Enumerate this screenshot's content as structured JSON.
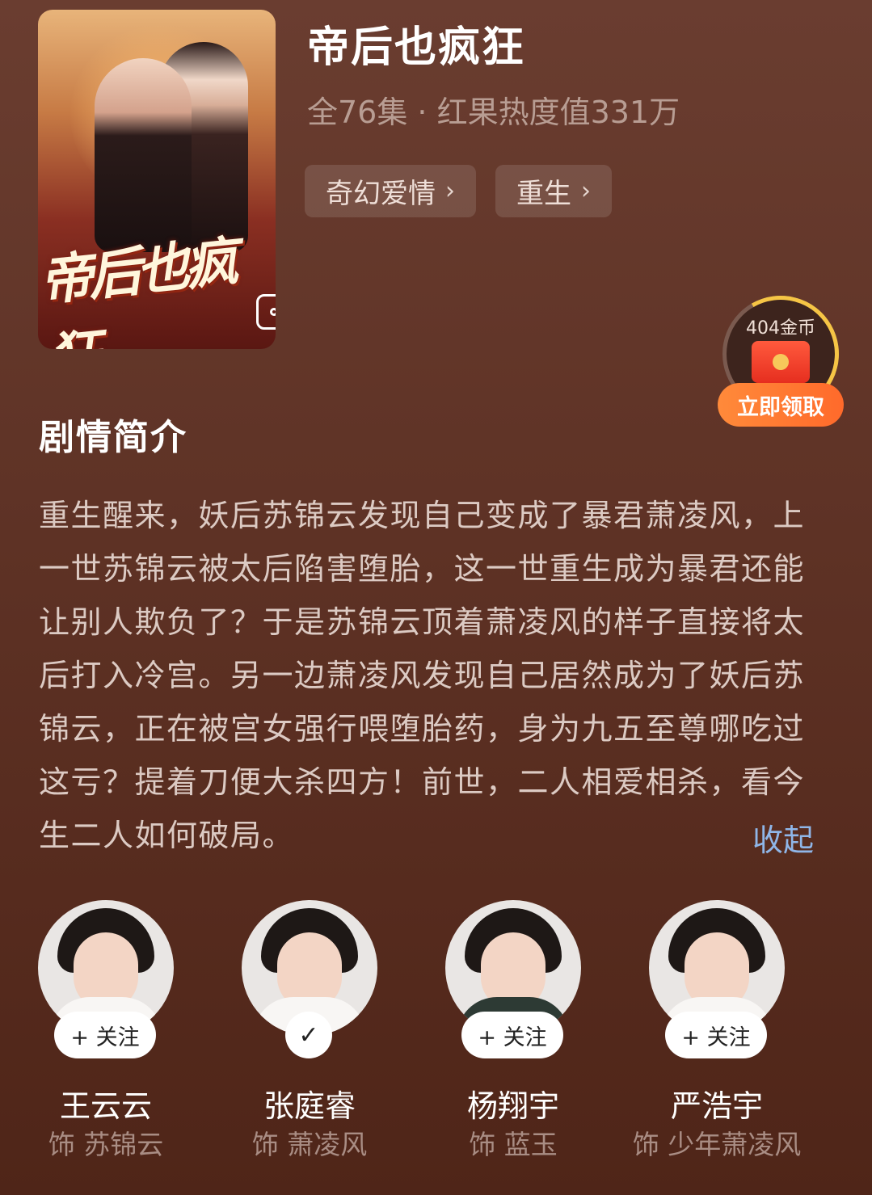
{
  "drama": {
    "title": "帝后也疯狂",
    "meta": "全76集 · 红果热度值331万",
    "poster_title": "帝后也疯狂",
    "tags": [
      {
        "label": "奇幻爱情"
      },
      {
        "label": "重生"
      }
    ]
  },
  "coin_widget": {
    "amount": "404金币",
    "button": "立即领取"
  },
  "synopsis": {
    "heading": "剧情简介",
    "text": "重生醒来，妖后苏锦云发现自己变成了暴君萧凌风，上一世苏锦云被太后陷害堕胎，这一世重生成为暴君还能让别人欺负了？于是苏锦云顶着萧凌风的样子直接将太后打入冷宫。另一边萧凌风发现自己居然成为了妖后苏锦云，正在被宫女强行喂堕胎药，身为九五至尊哪吃过这亏？提着刀便大杀四方！前世，二人相爱相杀，看今生二人如何破局。",
    "collapse_label": "收起"
  },
  "cast": [
    {
      "name": "王云云",
      "role": "饰 苏锦云",
      "follow": "+ 关注",
      "followed": false
    },
    {
      "name": "张庭睿",
      "role": "饰 萧凌风",
      "follow": "✓",
      "followed": true
    },
    {
      "name": "杨翔宇",
      "role": "饰 蓝玉",
      "follow": "+ 关注",
      "followed": false
    },
    {
      "name": "严浩宇",
      "role": "饰 少年萧凌风",
      "follow": "+ 关注",
      "followed": false
    }
  ]
}
